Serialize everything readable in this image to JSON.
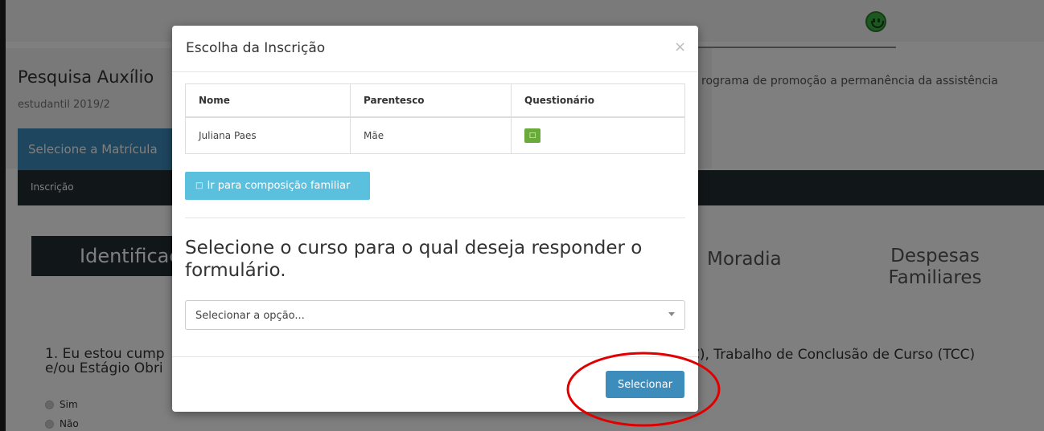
{
  "background": {
    "page_title": "Pesquisa Auxílio",
    "page_title_continuation": "rograma de promoção a permanência da assistência",
    "page_subtitle": "estudantil 2019/2",
    "select_tab": "Selecione a Matrícula",
    "breadcrumb": "Inscrição",
    "steps": {
      "identification": "Identificação",
      "housing": "Moradia",
      "expenses": "Despesas Familiares"
    },
    "question": {
      "line1_left": "1. Eu estou cump",
      "line2_left": "e/ou Estágio Obri",
      "line1_right": "C), Trabalho de Conclusão de Curso (TCC)",
      "options": [
        "Sim",
        "Não"
      ]
    },
    "status_icon": "smiley-icon",
    "status_color": "#3cb043"
  },
  "modal": {
    "title": "Escolha da Inscrição",
    "close_label": "×",
    "table": {
      "columns": [
        "Nome",
        "Parentesco",
        "Questionário"
      ],
      "rows": [
        {
          "name": "Juliana Paes",
          "relation": "Mãe",
          "action_icon": "□",
          "action_color": "#6aaa3a"
        }
      ]
    },
    "family_button": {
      "icon": "□",
      "label": "Ir para composição familiar"
    },
    "course_heading": "Selecione o curso para o qual deseja responder o formulário.",
    "course_select": {
      "value": "Selecionar a opção..."
    },
    "submit_label": "Selecionar",
    "colors": {
      "primary": "#3c8dbc",
      "info": "#5bc0de",
      "success": "#6aaa3a",
      "annotation": "#e00000"
    }
  }
}
